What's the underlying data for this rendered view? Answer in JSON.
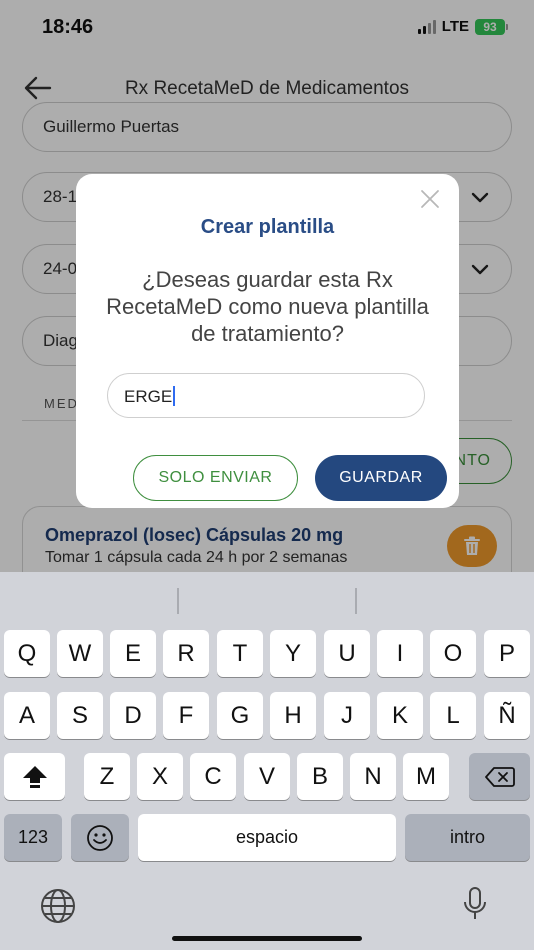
{
  "status_bar": {
    "time": "18:46",
    "network": "LTE",
    "battery": "93"
  },
  "header": {
    "title": "Rx RecetaMeD de Medicamentos"
  },
  "form": {
    "patient_name": "Guillermo Puertas",
    "date1_partial": "28-1",
    "date2_partial": "24-0",
    "diagnosis_partial": "Diag",
    "section_label": "MED",
    "add_button_partial": "NTO"
  },
  "medication": {
    "name": "Omeprazol (losec) Cápsulas 20 mg",
    "dosage": "Tomar 1 cápsula  cada 24 h por 2 semanas"
  },
  "dialog": {
    "title": "Crear plantilla",
    "message": "¿Deseas guardar esta Rx RecetaMeD como nueva plantilla de tratamiento?",
    "input_value": "ERGE",
    "solo_enviar_label": "SOLO ENVIAR",
    "guardar_label": "GUARDAR"
  },
  "keyboard": {
    "row1": [
      "Q",
      "W",
      "E",
      "R",
      "T",
      "Y",
      "U",
      "I",
      "O",
      "P"
    ],
    "row2": [
      "A",
      "S",
      "D",
      "F",
      "G",
      "H",
      "J",
      "K",
      "L",
      "Ñ"
    ],
    "row3": [
      "Z",
      "X",
      "C",
      "V",
      "B",
      "N",
      "M"
    ],
    "numbers_key": "123",
    "space_key": "espacio",
    "return_key": "intro"
  },
  "colors": {
    "brand_blue": "#24487f",
    "green": "#3f8f3f",
    "trash_orange": "#ef9a2b",
    "battery_green": "#34c759"
  },
  "icons": [
    "back-arrow-icon",
    "chevron-down-icon",
    "close-icon",
    "trash-icon",
    "shift-icon",
    "backspace-icon",
    "emoji-icon",
    "globe-icon",
    "microphone-icon"
  ]
}
